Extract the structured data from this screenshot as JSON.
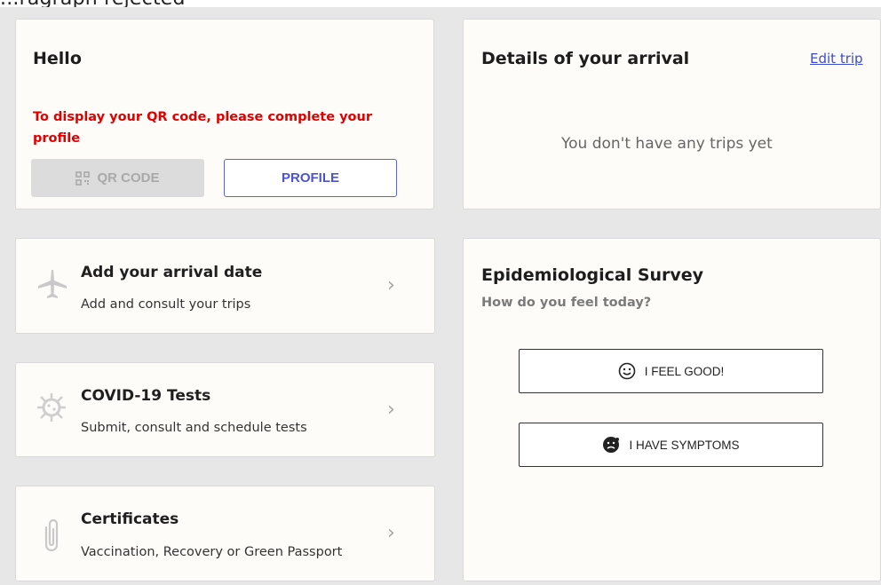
{
  "top_fragment": "...ragraph rejected",
  "hello_card": {
    "title": "Hello",
    "warning": "To display your QR code, please complete your profile",
    "qr_button": "QR CODE",
    "profile_button": "PROFILE"
  },
  "arrival_card": {
    "title": "Details of your arrival",
    "edit_link": "Edit trip",
    "empty_text": "You don't have any trips yet"
  },
  "menu_items": [
    {
      "title": "Add your arrival date",
      "subtitle": "Add and consult your trips",
      "icon": "airplane-icon"
    },
    {
      "title": "COVID-19 Tests",
      "subtitle": "Submit, consult and schedule tests",
      "icon": "virus-icon"
    },
    {
      "title": "Certificates",
      "subtitle": "Vaccination, Recovery or Green Passport",
      "icon": "paperclip-icon"
    }
  ],
  "survey": {
    "title": "Epidemiological Survey",
    "question": "How do you feel today?",
    "good_button": "I FEEL GOOD!",
    "symptoms_button": "I HAVE SYMPTOMS"
  },
  "colors": {
    "accent": "#4d54c9",
    "warning": "#e00000",
    "background": "#e7e7e7",
    "card": "#fdfcf8"
  }
}
